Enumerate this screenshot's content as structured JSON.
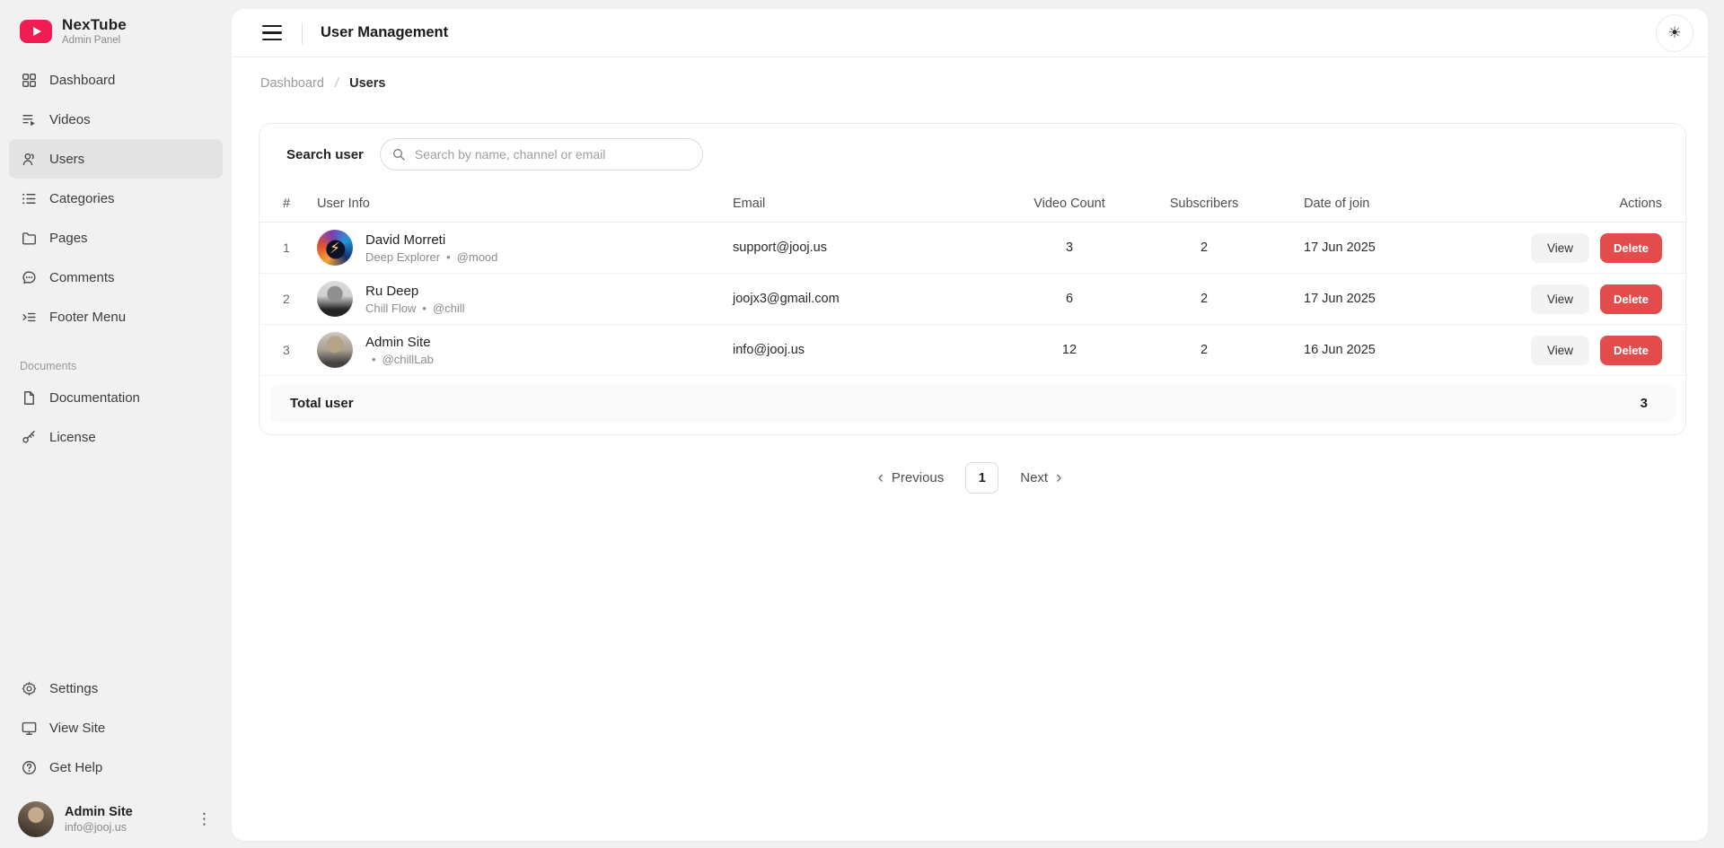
{
  "colors": {
    "brand": "#f01d52",
    "danger": "#e34c4c",
    "page_background": "#f1f0f0",
    "active_item_background": "#e4e3e3"
  },
  "brand": {
    "name": "NexTube",
    "subtitle": "Admin Panel",
    "logo_icon": "play-icon"
  },
  "sidebar": {
    "nav": [
      {
        "label": "Dashboard",
        "icon": "grid-icon"
      },
      {
        "label": "Videos",
        "icon": "video-list-icon"
      },
      {
        "label": "Users",
        "icon": "users-icon",
        "active": true
      },
      {
        "label": "Categories",
        "icon": "list-icon"
      },
      {
        "label": "Pages",
        "icon": "folder-icon"
      },
      {
        "label": "Comments",
        "icon": "comment-icon"
      },
      {
        "label": "Footer Menu",
        "icon": "footer-menu-icon"
      }
    ],
    "documents_label": "Documents",
    "documents": [
      {
        "label": "Documentation",
        "icon": "file-icon"
      },
      {
        "label": "License",
        "icon": "key-icon"
      }
    ],
    "bottom": [
      {
        "label": "Settings",
        "icon": "gear-icon"
      },
      {
        "label": "View Site",
        "icon": "monitor-icon"
      },
      {
        "label": "Get Help",
        "icon": "help-icon"
      }
    ],
    "profile": {
      "name": "Admin Site",
      "email": "info@jooj.us",
      "menu_icon": "kebab-icon"
    }
  },
  "header": {
    "title": "User Management",
    "menu_icon": "hamburger-icon",
    "theme_toggle_icon": "sun-icon"
  },
  "breadcrumb": {
    "dashboard": "Dashboard",
    "current": "Users"
  },
  "search": {
    "label": "Search user",
    "placeholder": "Search by name, channel or email",
    "icon": "search-icon"
  },
  "table": {
    "headers": {
      "index": "#",
      "user": "User Info",
      "email": "Email",
      "videos": "Video Count",
      "subscribers": "Subscribers",
      "date": "Date of join",
      "actions": "Actions"
    },
    "rows": [
      {
        "index": "1",
        "name": "David Morreti",
        "channel": "Deep Explorer",
        "handle": "@mood",
        "email": "support@jooj.us",
        "videos": "3",
        "subscribers": "2",
        "date": "17 Jun 2025",
        "avatar": "galaxy-bolt"
      },
      {
        "index": "2",
        "name": "Ru Deep",
        "channel": "Chill Flow",
        "handle": "@chill",
        "email": "joojx3@gmail.com",
        "videos": "6",
        "subscribers": "2",
        "date": "17 Jun 2025",
        "avatar": "bw-portrait"
      },
      {
        "index": "3",
        "name": "Admin Site",
        "channel": "",
        "handle": "@chillLab",
        "email": "info@jooj.us",
        "videos": "12",
        "subscribers": "2",
        "date": "16 Jun 2025",
        "avatar": "man-portrait"
      }
    ],
    "actions": {
      "view": "View",
      "delete": "Delete"
    },
    "footer": {
      "label": "Total user",
      "value": "3"
    }
  },
  "pagination": {
    "previous": "Previous",
    "page": "1",
    "next": "Next"
  },
  "glyphs": {
    "sun": "☀",
    "kebab": "⋮",
    "bolt": "⚡",
    "chevron_left": "‹",
    "chevron_right": "›",
    "slash": "/",
    "bullet": "•"
  }
}
